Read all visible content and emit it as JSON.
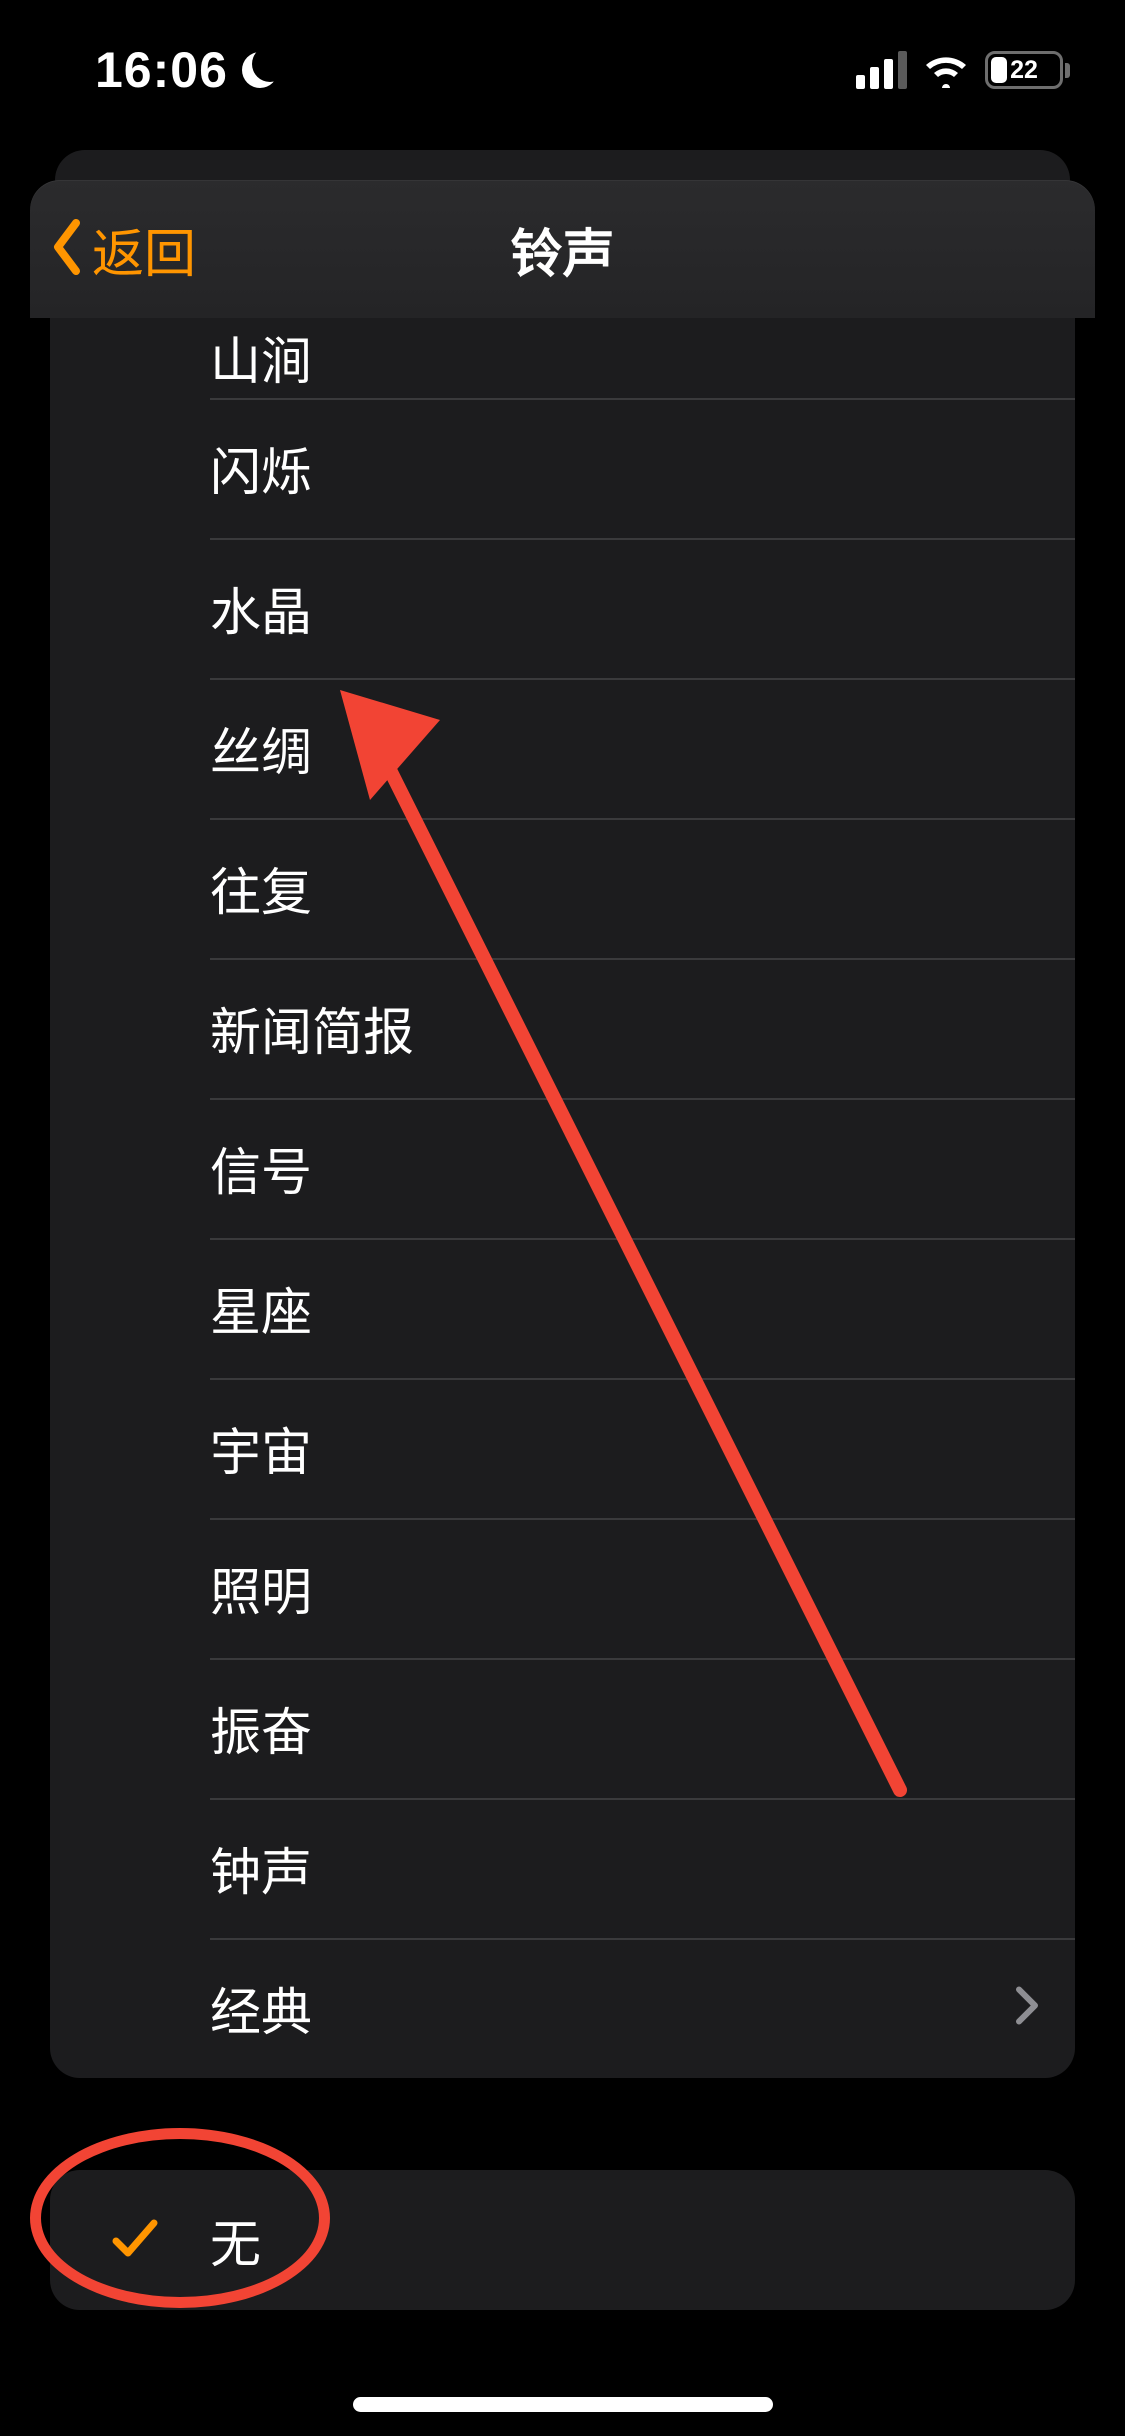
{
  "status": {
    "time": "16:06",
    "battery_percent": "22"
  },
  "nav": {
    "back_label": "返回",
    "title": "铃声"
  },
  "list": [
    {
      "label": "山涧",
      "disclosure": false,
      "partial_top": true
    },
    {
      "label": "闪烁",
      "disclosure": false
    },
    {
      "label": "水晶",
      "disclosure": false
    },
    {
      "label": "丝绸",
      "disclosure": false
    },
    {
      "label": "往复",
      "disclosure": false
    },
    {
      "label": "新闻简报",
      "disclosure": false
    },
    {
      "label": "信号",
      "disclosure": false
    },
    {
      "label": "星座",
      "disclosure": false
    },
    {
      "label": "宇宙",
      "disclosure": false
    },
    {
      "label": "照明",
      "disclosure": false
    },
    {
      "label": "振奋",
      "disclosure": false
    },
    {
      "label": "钟声",
      "disclosure": false
    },
    {
      "label": "经典",
      "disclosure": true
    }
  ],
  "none_row": {
    "label": "无",
    "selected": true
  },
  "colors": {
    "accent": "#ff9500",
    "annotation": "#f24434",
    "panel": "#1c1c1e",
    "separator": "#3a3a3c"
  }
}
